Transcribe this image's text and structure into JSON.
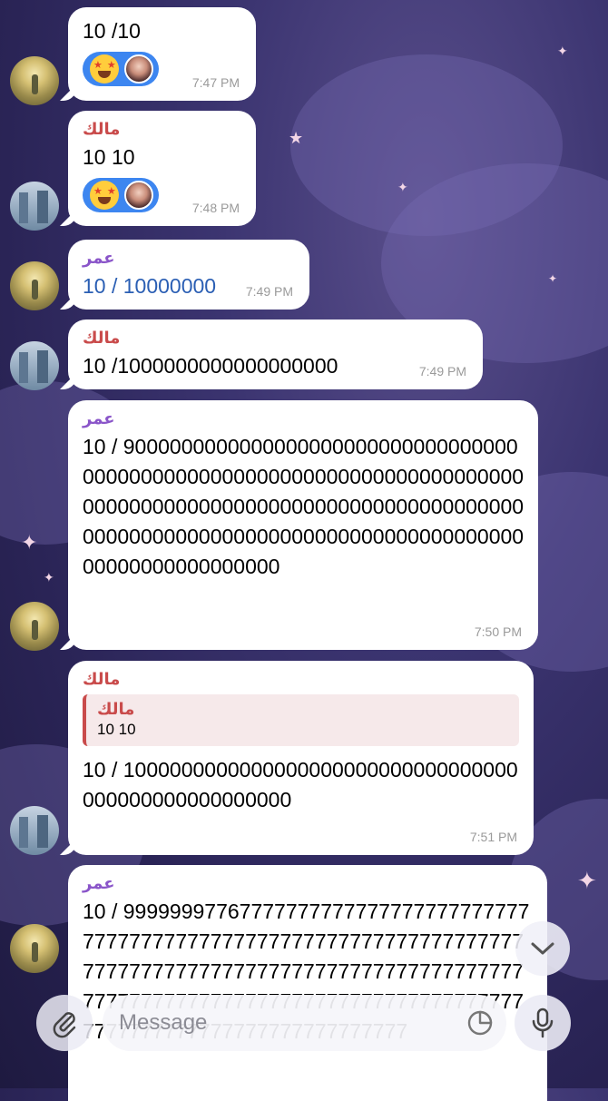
{
  "colors": {
    "sender_malik": "#c94b4b",
    "sender_omar": "#8a55c9",
    "link": "#2b5fb4",
    "reaction_bg": "#3d86f0"
  },
  "messages": [
    {
      "text": "10 /10",
      "time": "7:47 PM",
      "reactions": [
        "star-struck-emoji",
        "avatar"
      ]
    },
    {
      "sender": "مالك",
      "text": "10 10",
      "time": "7:48 PM",
      "reactions": [
        "star-struck-emoji",
        "avatar"
      ]
    },
    {
      "sender": "عمر",
      "text": "10 / 10000000",
      "time": "7:49 PM"
    },
    {
      "sender": "مالك",
      "text": "10 /1000000000000000000",
      "time": "7:49 PM"
    },
    {
      "sender": "عمر",
      "text": "10 / 900000000000000000000000000000000000000000000000000000000000000000000000000000000000000000000000000000000000000000000000000000000000000000000000000000000000000000000",
      "time": "7:50 PM"
    },
    {
      "sender": "مالك",
      "reply": {
        "sender": "مالك",
        "text": "10 10"
      },
      "text": "10 / 1000000000000000000000000000000000000000000000000000",
      "time": "7:51 PM"
    },
    {
      "sender": "عمر",
      "text": "10 / 999999977677777777777777777777777777777777777777777777777777777777777777777777777777777777777777777777777777777777777777777777777777777777777777777777777777777777777777777777777"
    }
  ],
  "input": {
    "placeholder": "Message"
  },
  "icons": {
    "attach": "paperclip-icon",
    "sticker": "sticker-icon",
    "mic": "microphone-icon",
    "scroll_down": "chevron-down-icon"
  }
}
